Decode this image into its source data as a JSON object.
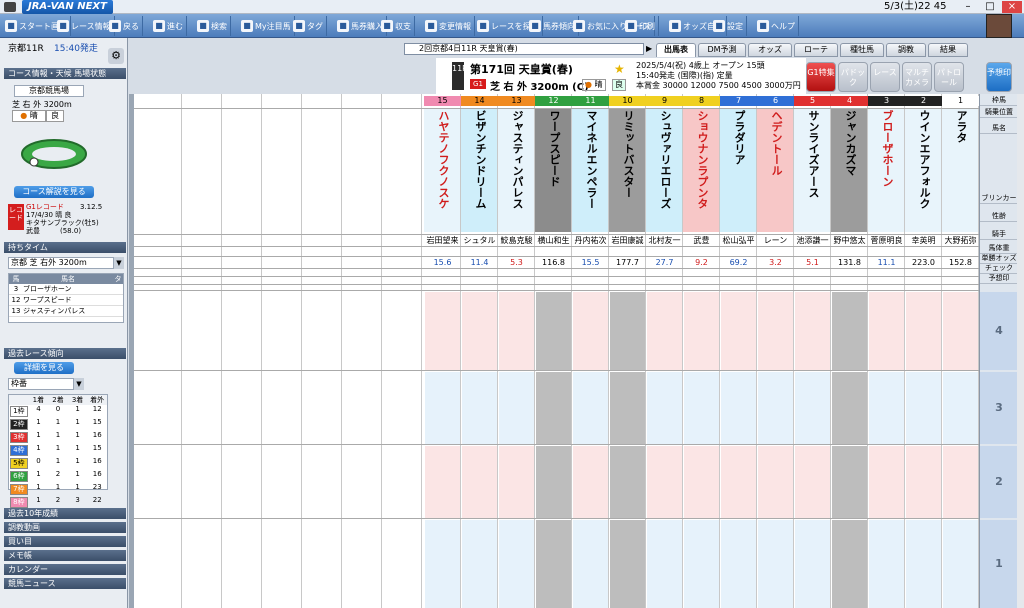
{
  "titlebar": {
    "app_name": "JRA-VAN NEXT",
    "datetime": "5/3(土)22 45"
  },
  "toolbar": [
    {
      "label": "スタート画面",
      "icon": "home-icon"
    },
    {
      "label": "レース情報",
      "icon": "race-info-icon"
    },
    {
      "label": "戻る",
      "icon": "back-icon"
    },
    {
      "label": "進む",
      "icon": "forward-icon"
    },
    {
      "label": "検索",
      "icon": "search-icon"
    },
    {
      "label": "My注目馬",
      "icon": "star-icon"
    },
    {
      "label": "タグ",
      "icon": "tag-icon"
    },
    {
      "label": "馬券購入",
      "icon": "ticket-icon"
    },
    {
      "label": "収支",
      "icon": "money-icon"
    },
    {
      "label": "変更情報",
      "icon": "change-icon"
    },
    {
      "label": "レースを探す",
      "icon": "find-icon"
    },
    {
      "label": "馬券傾向",
      "icon": "trend-icon"
    },
    {
      "label": "お気に入りレース",
      "icon": "favorite-icon"
    },
    {
      "label": "印刷",
      "icon": "print-icon"
    },
    {
      "label": "オッズ自動",
      "icon": "odds-icon"
    },
    {
      "label": "設定",
      "icon": "gear-icon"
    },
    {
      "label": "ヘルプ",
      "icon": "help-icon"
    }
  ],
  "left": {
    "race_place": "京都11R",
    "start_time": "15:40発走",
    "section_course": "コース情報・天候 馬場状態",
    "venue": "京都競馬場",
    "course": "芝 右 外 3200m",
    "weather": "晴",
    "going": "良",
    "course_btn": "コース解説を見る",
    "record_label": "レコード",
    "record_title": "G1レコード",
    "record_time": "3.12.5",
    "record_date": "17/4/30 晴 良",
    "record_horse": "キタサンブラック(牡5)",
    "record_jockey": "武豊",
    "record_weight": "(58.0)",
    "section_time": "持ちタイム",
    "time_select": "京都 芝 右外 3200m",
    "time_headers": [
      "馬",
      "馬名",
      "タ"
    ],
    "time_rows": [
      {
        "no": "3",
        "name": "ブローザホーン"
      },
      {
        "no": "12",
        "name": "ワープスピード"
      },
      {
        "no": "13",
        "name": "ジャスティンパレス"
      }
    ],
    "section_past": "過去レース傾向",
    "detail_btn": "詳細を見る",
    "past_select": "枠番",
    "past_headers": [
      "1着",
      "2着",
      "3着",
      "着外"
    ],
    "past_rows": [
      {
        "w": "1枠",
        "v": [
          "4",
          "0",
          "1",
          "12"
        ]
      },
      {
        "w": "2枠",
        "v": [
          "1",
          "1",
          "1",
          "15"
        ]
      },
      {
        "w": "3枠",
        "v": [
          "1",
          "1",
          "1",
          "16"
        ]
      },
      {
        "w": "4枠",
        "v": [
          "1",
          "1",
          "1",
          "15"
        ]
      },
      {
        "w": "5枠",
        "v": [
          "0",
          "1",
          "1",
          "16"
        ]
      },
      {
        "w": "6枠",
        "v": [
          "1",
          "2",
          "1",
          "16"
        ]
      },
      {
        "w": "7枠",
        "v": [
          "1",
          "1",
          "1",
          "23"
        ]
      },
      {
        "w": "8枠",
        "v": [
          "1",
          "2",
          "3",
          "22"
        ]
      }
    ],
    "menu": [
      "過去10年成績",
      "調教動画",
      "買い目",
      "メモ帳",
      "カレンダー",
      "競馬ニュース"
    ]
  },
  "race_select": "2回京都4日11R 天皇賞(春)",
  "tabs": [
    "出馬表",
    "DM予測",
    "オッズ",
    "ローテ",
    "種牡馬",
    "調教",
    "結果"
  ],
  "race": {
    "number": "11R",
    "title": "第171回 天皇賞(春)",
    "grade": "G1",
    "course": "芝 右 外 3200m (C)",
    "weather": "晴",
    "going": "良",
    "date_line": "2025/5/4(祝) 4歳上 オープン 15頭",
    "time_line": "15:40発走 (国際)(指) 定量",
    "prize_line": "本賞金 30000 12000 7500 4500 3000万円"
  },
  "gbuttons": [
    "G1特集",
    "パドック",
    "レース",
    "マルチカメラ",
    "パトロール",
    "予想印"
  ],
  "horses": [
    {
      "no": "15",
      "waku": "8",
      "name": "ハヤテノフクノスケ",
      "jockey": "岩田望来",
      "odds": "15.6"
    },
    {
      "no": "14",
      "waku": "7",
      "name": "ビザンチンドリーム",
      "jockey": "シュタル",
      "odds": "11.4"
    },
    {
      "no": "13",
      "waku": "7",
      "name": "ジャスティンパレス",
      "jockey": "鮫島克駿",
      "odds": "5.3"
    },
    {
      "no": "12",
      "waku": "6",
      "name": "ワープスピード",
      "jockey": "横山和生",
      "odds": "116.8"
    },
    {
      "no": "11",
      "waku": "6",
      "name": "マイネルエンペラー",
      "jockey": "丹内祐次",
      "odds": "15.5"
    },
    {
      "no": "10",
      "waku": "5",
      "name": "リミットバスター",
      "jockey": "岩田康誠",
      "odds": "177.7"
    },
    {
      "no": "9",
      "waku": "5",
      "name": "シュヴァリエローズ",
      "jockey": "北村友一",
      "odds": "27.7"
    },
    {
      "no": "8",
      "waku": "5",
      "name": "ショウナンラプンタ",
      "jockey": "武豊",
      "odds": "9.2"
    },
    {
      "no": "7",
      "waku": "4",
      "name": "プラダリア",
      "jockey": "松山弘平",
      "odds": "69.2"
    },
    {
      "no": "6",
      "waku": "4",
      "name": "ヘデントール",
      "jockey": "レーン",
      "odds": "3.2"
    },
    {
      "no": "5",
      "waku": "3",
      "name": "サンライズアース",
      "jockey": "池添謙一",
      "odds": "5.1"
    },
    {
      "no": "4",
      "waku": "3",
      "name": "ジャンカズマ",
      "jockey": "野中悠太",
      "odds": "131.8"
    },
    {
      "no": "3",
      "waku": "2",
      "name": "ブローザホーン",
      "jockey": "菅原明良",
      "odds": "11.1"
    },
    {
      "no": "2",
      "waku": "2",
      "name": "ウインエアフォルク",
      "jockey": "幸英明",
      "odds": "223.0"
    },
    {
      "no": "1",
      "waku": "1",
      "name": "アラタ",
      "jockey": "大野拓弥",
      "odds": "152.8"
    }
  ],
  "right_labels": [
    "枠馬",
    "騎乗位置",
    "馬名",
    "ブリンカー",
    "性齢",
    "騎手",
    "馬体重",
    "単勝オッズ",
    "チェック",
    "予想印"
  ],
  "right_big": [
    "4",
    "3",
    "2",
    "1"
  ],
  "colors": {
    "waku1": "#ffffff",
    "waku2": "#222222",
    "waku3": "#e03030",
    "waku4": "#2f6fd6",
    "waku5": "#f0d020",
    "waku6": "#30a040",
    "waku7": "#f08a20",
    "waku8": "#f08ab0"
  }
}
